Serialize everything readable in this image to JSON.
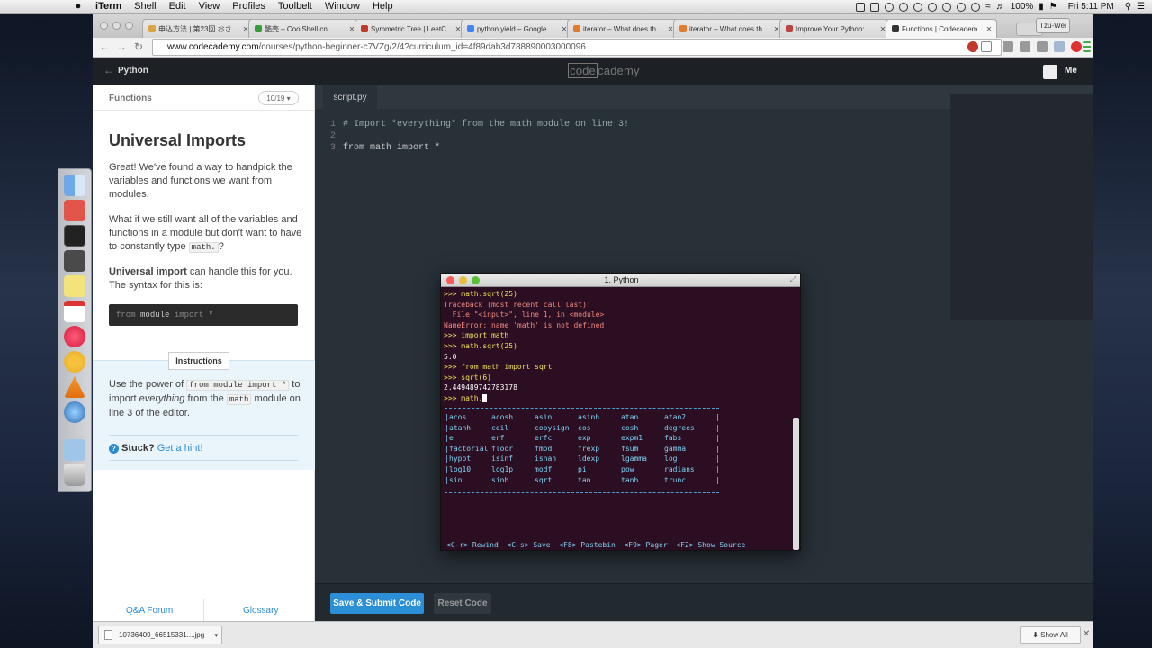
{
  "mac_menubar": {
    "app": "iTerm",
    "items": [
      "Shell",
      "Edit",
      "View",
      "Profiles",
      "Toolbelt",
      "Window",
      "Help"
    ],
    "battery": "100%",
    "clock": "Fri 5:11 PM"
  },
  "browser": {
    "tabs": [
      {
        "label": "申込方法 | 第23回 おさ",
        "favicon_color": "#d9a441"
      },
      {
        "label": "酷壳 – CoolShell.cn",
        "favicon_color": "#3a9b3a"
      },
      {
        "label": "Symmetric Tree | LeetC",
        "favicon_color": "#c0392b"
      },
      {
        "label": "python yield – Google",
        "favicon_color": "#4285f4"
      },
      {
        "label": "iterator – What does th",
        "favicon_color": "#e37b2f"
      },
      {
        "label": "iterator – What does th",
        "favicon_color": "#e37b2f"
      },
      {
        "label": "Improve Your Python: ",
        "favicon_color": "#b44"
      },
      {
        "label": "Functions | Codecadem",
        "favicon_color": "#333333"
      }
    ],
    "profile": "Tzu-Wei",
    "url_host": "www.codecademy.com",
    "url_path": "/courses/python-beginner-c7VZg/2/4?curriculum_id=4f89dab3d788890003000096"
  },
  "codecademy": {
    "course": "Python",
    "logo_box": "code",
    "logo_rest": "cademy",
    "user": "Me",
    "unit": "Functions",
    "pager": "10/19",
    "lesson_title": "Universal Imports",
    "p1": "Great! We've found a way to handpick the variables and functions we want from modules.",
    "p2_before": "What if we still want all of the variables and functions in a module but don't want to have to constantly type ",
    "p2_code": "math.",
    "p2_after": "?",
    "p3_bold": "Universal import",
    "p3_rest": " can handle this for you. The syntax for this is:",
    "syntax_from": "from",
    "syntax_module": "module",
    "syntax_import": "import",
    "syntax_star": "*",
    "instructions_label": "Instructions",
    "instr_1": "Use the power of ",
    "instr_code1": "from module import *",
    "instr_2": " to import ",
    "instr_em": "everything",
    "instr_3": " from the ",
    "instr_code2": "math",
    "instr_4": " module on line 3 of the editor.",
    "stuck": "Stuck?",
    "hint": " Get a hint!",
    "footer_left": "Q&A Forum",
    "footer_right": "Glossary",
    "file_tab": "script.py",
    "code_lines": [
      {
        "n": "1",
        "text": "# Import *everything* from the math module on line 3!"
      },
      {
        "n": "2",
        "text": ""
      },
      {
        "n": "3",
        "text": "from math import *"
      }
    ],
    "submit": "Save & Submit Code",
    "reset": "Reset Code"
  },
  "terminal": {
    "title": "1. Python",
    "lines": [
      {
        "cls": "p",
        "prompt": ">>> ",
        "text": "math.sqrt(25)"
      },
      {
        "cls": "err",
        "prompt": "",
        "text": "Traceback (most recent call last):"
      },
      {
        "cls": "err",
        "prompt": "",
        "text": "  File \"<input>\", line 1, in <module>"
      },
      {
        "cls": "err",
        "prompt": "",
        "text": "NameError: name 'math' is not defined"
      },
      {
        "cls": "p",
        "prompt": ">>> ",
        "text": "import math"
      },
      {
        "cls": "p",
        "prompt": ">>> ",
        "text": "math.sqrt(25)"
      },
      {
        "cls": "out",
        "prompt": "",
        "text": "5.0"
      },
      {
        "cls": "p",
        "prompt": ">>> ",
        "text": "from math import sqrt"
      },
      {
        "cls": "p",
        "prompt": ">>> ",
        "text": "sqrt(6)"
      },
      {
        "cls": "out",
        "prompt": "",
        "text": "2.449489742783178"
      },
      {
        "cls": "p",
        "prompt": ">>> ",
        "text": "math."
      }
    ],
    "completions": [
      [
        "acos",
        "acosh",
        "asin",
        "asinh",
        "atan",
        "atan2"
      ],
      [
        "atanh",
        "ceil",
        "copysign",
        "cos",
        "cosh",
        "degrees"
      ],
      [
        "e",
        "erf",
        "erfc",
        "exp",
        "expm1",
        "fabs"
      ],
      [
        "factorial",
        "floor",
        "fmod",
        "frexp",
        "fsum",
        "gamma"
      ],
      [
        "hypot",
        "isinf",
        "isnan",
        "ldexp",
        "lgamma",
        "log"
      ],
      [
        "log10",
        "log1p",
        "modf",
        "pi",
        "pow",
        "radians"
      ],
      [
        "sin",
        "sinh",
        "sqrt",
        "tan",
        "tanh",
        "trunc"
      ]
    ],
    "help_bar": "<C-r> Rewind  <C-s> Save  <F8> Pastebin  <F9> Pager  <F2> Show Source"
  },
  "downloads": {
    "file": "10736409_66515331....jpg",
    "show_all": "Show All"
  }
}
